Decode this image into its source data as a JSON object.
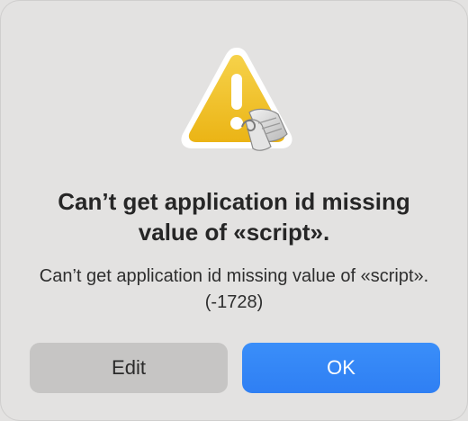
{
  "dialog": {
    "icon": "warning-triangle-script-icon",
    "title": "Can’t get application id missing value of «script».",
    "message": "Can’t get application id missing value of «script». (-1728)",
    "buttons": {
      "edit_label": "Edit",
      "ok_label": "OK"
    }
  },
  "colors": {
    "background": "#e3e2e1",
    "accent": "#3182f6",
    "warning": "#f3c21b"
  }
}
